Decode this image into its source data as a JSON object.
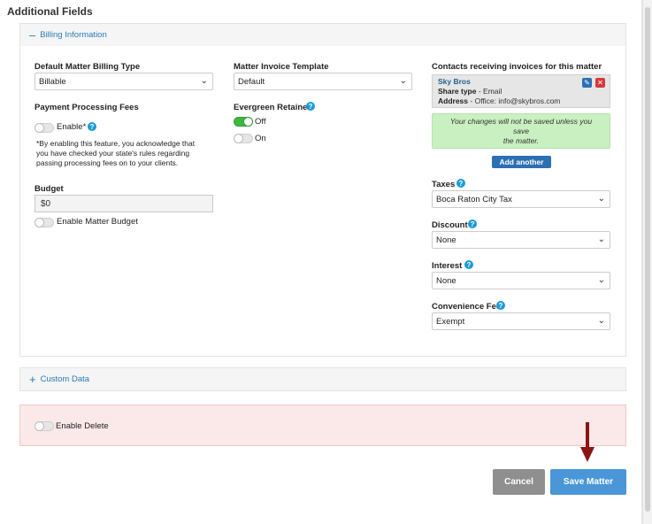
{
  "page": {
    "title": "Additional Fields"
  },
  "billing": {
    "header": "Billing Information",
    "billing_type": {
      "label": "Default Matter Billing Type",
      "value": "Billable"
    },
    "invoice_template": {
      "label": "Matter Invoice Template",
      "value": "Default"
    },
    "processing_fees": {
      "label": "Payment Processing Fees",
      "toggle_label": "Enable*",
      "note_lines": [
        "*By enabling this feature, you acknowledge that",
        "you have checked your state's rules regarding",
        "passing processing fees on to your clients."
      ]
    },
    "evergreen": {
      "label": "Evergreen Retainer",
      "off_label": "Off",
      "on_label": "On"
    },
    "budget": {
      "label": "Budget",
      "value": "$0",
      "toggle_label": "Enable Matter Budget"
    },
    "contacts": {
      "label": "Contacts receiving invoices for this matter",
      "name": "Sky Bros",
      "share_type_label": "Share type",
      "share_type_value": "- Email",
      "address_label": "Address",
      "address_value": "- Office: info@skybros.com",
      "warning_line1": "Your changes will not be saved unless you save",
      "warning_line2": "the matter.",
      "add_another": "Add another"
    },
    "taxes": {
      "label": "Taxes",
      "value": "Boca Raton City Tax"
    },
    "discount": {
      "label": "Discount",
      "value": "None"
    },
    "interest": {
      "label": "Interest",
      "value": "None"
    },
    "convenience_fee": {
      "label": "Convenience Fee",
      "value": "Exempt"
    }
  },
  "custom_data": {
    "header": "Custom Data"
  },
  "delete": {
    "toggle_label": "Enable Delete"
  },
  "actions": {
    "cancel": "Cancel",
    "save": "Save Matter"
  },
  "icons": {
    "help": "question-circle-icon",
    "edit": "pencil-icon",
    "remove": "close-icon",
    "chevron": "chevron-down-icon",
    "arrow": "arrow-down-icon"
  },
  "colors": {
    "accent": "#2a7ab8",
    "toggle_on": "#3fb73f",
    "help": "#1a9ad6",
    "save": "#4a96d8",
    "cancel": "#8f8f8f",
    "warning_bg": "#c9f0c0",
    "delete_bg": "#fbe8e8",
    "arrow": "#8b1414"
  }
}
